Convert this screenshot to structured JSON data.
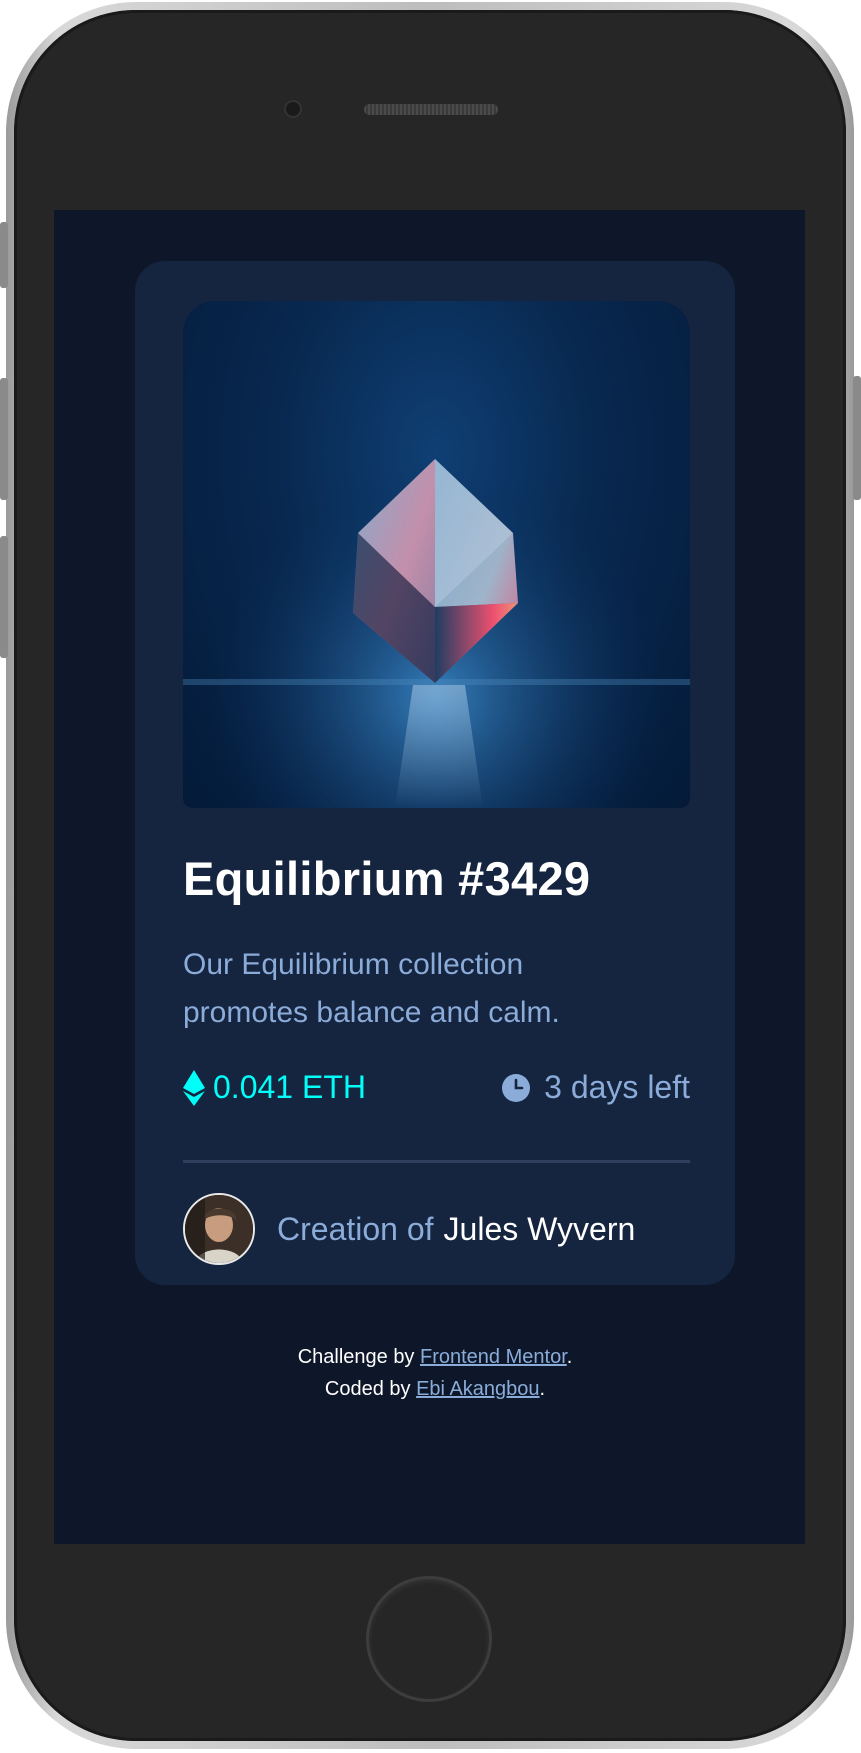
{
  "nft_card": {
    "title": "Equilibrium #3429",
    "description": "Our Equilibrium collection promotes balance and calm.",
    "price": "0.041 ETH",
    "time_left": "3 days left",
    "creator_prefix": "Creation of",
    "creator_name": "Jules Wyvern",
    "icons": {
      "price": "ethereum-icon",
      "time": "clock-icon"
    }
  },
  "attribution": {
    "challenge_prefix": "Challenge by",
    "challenge_link": "Frontend Mentor",
    "coded_prefix": "Coded by",
    "coded_link": "Ebi Akangbou",
    "period": "."
  },
  "colors": {
    "page_bg": "#0d1729",
    "card_bg": "#15243f",
    "accent_cyan": "#00fff8",
    "soft_blue": "#8bacd9",
    "white": "#ffffff"
  }
}
